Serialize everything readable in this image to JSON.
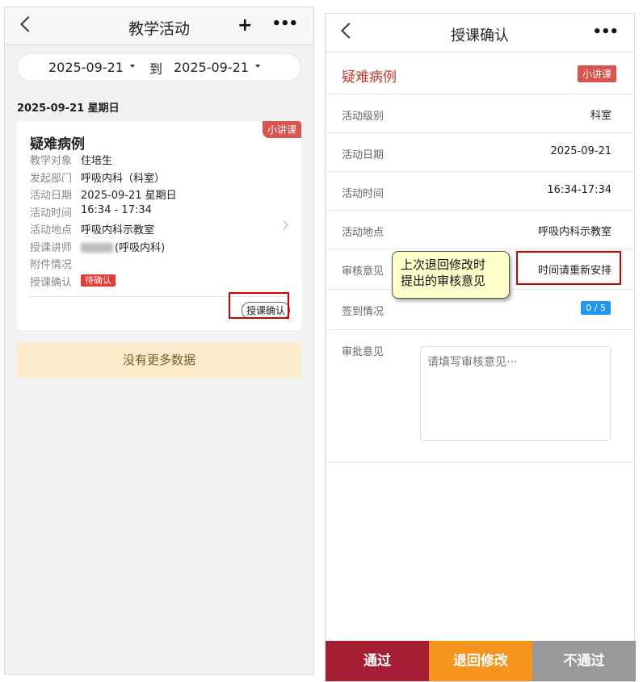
{
  "left": {
    "title": "教学活动",
    "date_from": "2025-09-21",
    "date_to_label": "到",
    "date_to": "2025-09-21",
    "day_header": "2025-09-21 星期日",
    "card": {
      "tag": "小讲课",
      "title": "疑难病例",
      "rows": [
        {
          "label": "教学对象",
          "value": "住培生"
        },
        {
          "label": "发起部门",
          "value": "呼吸内科（科室）"
        },
        {
          "label": "活动日期",
          "value": "2025-09-21 星期日"
        },
        {
          "label": "活动时间",
          "value": "16:34 - 17:34"
        },
        {
          "label": "活动地点",
          "value": "呼吸内科示教室"
        },
        {
          "label": "授课讲师",
          "value": "(呼吸内科)"
        },
        {
          "label": "附件情况",
          "value": ""
        },
        {
          "label": "授课确认",
          "value": "待确认"
        }
      ],
      "confirm_button": "授课确认"
    },
    "no_more": "没有更多数据"
  },
  "right": {
    "title": "授课确认",
    "activity_title": "疑难病例",
    "tag": "小讲课",
    "fields": [
      {
        "label": "活动级别",
        "value": "科室"
      },
      {
        "label": "活动日期",
        "value": "2025-09-21"
      },
      {
        "label": "活动时间",
        "value": "16:34-17:34"
      },
      {
        "label": "活动地点",
        "value": "呼吸内科示教室"
      },
      {
        "label": "审核意见",
        "value": "时间请重新安排"
      },
      {
        "label": "签到情况",
        "value": "0 / 5"
      }
    ],
    "approval_label": "审批意见",
    "approval_placeholder": "请填写审核意见···",
    "buttons": {
      "pass": "通过",
      "return": "退回修改",
      "reject": "不通过"
    }
  },
  "annotation": {
    "line1": "上次退回修改时",
    "line2": "提出的审核意见"
  },
  "colors": {
    "accent_red": "#a61e34",
    "orange": "#f7941d",
    "gray": "#999999",
    "tag_red": "#d9534f",
    "blue": "#2196f3"
  }
}
